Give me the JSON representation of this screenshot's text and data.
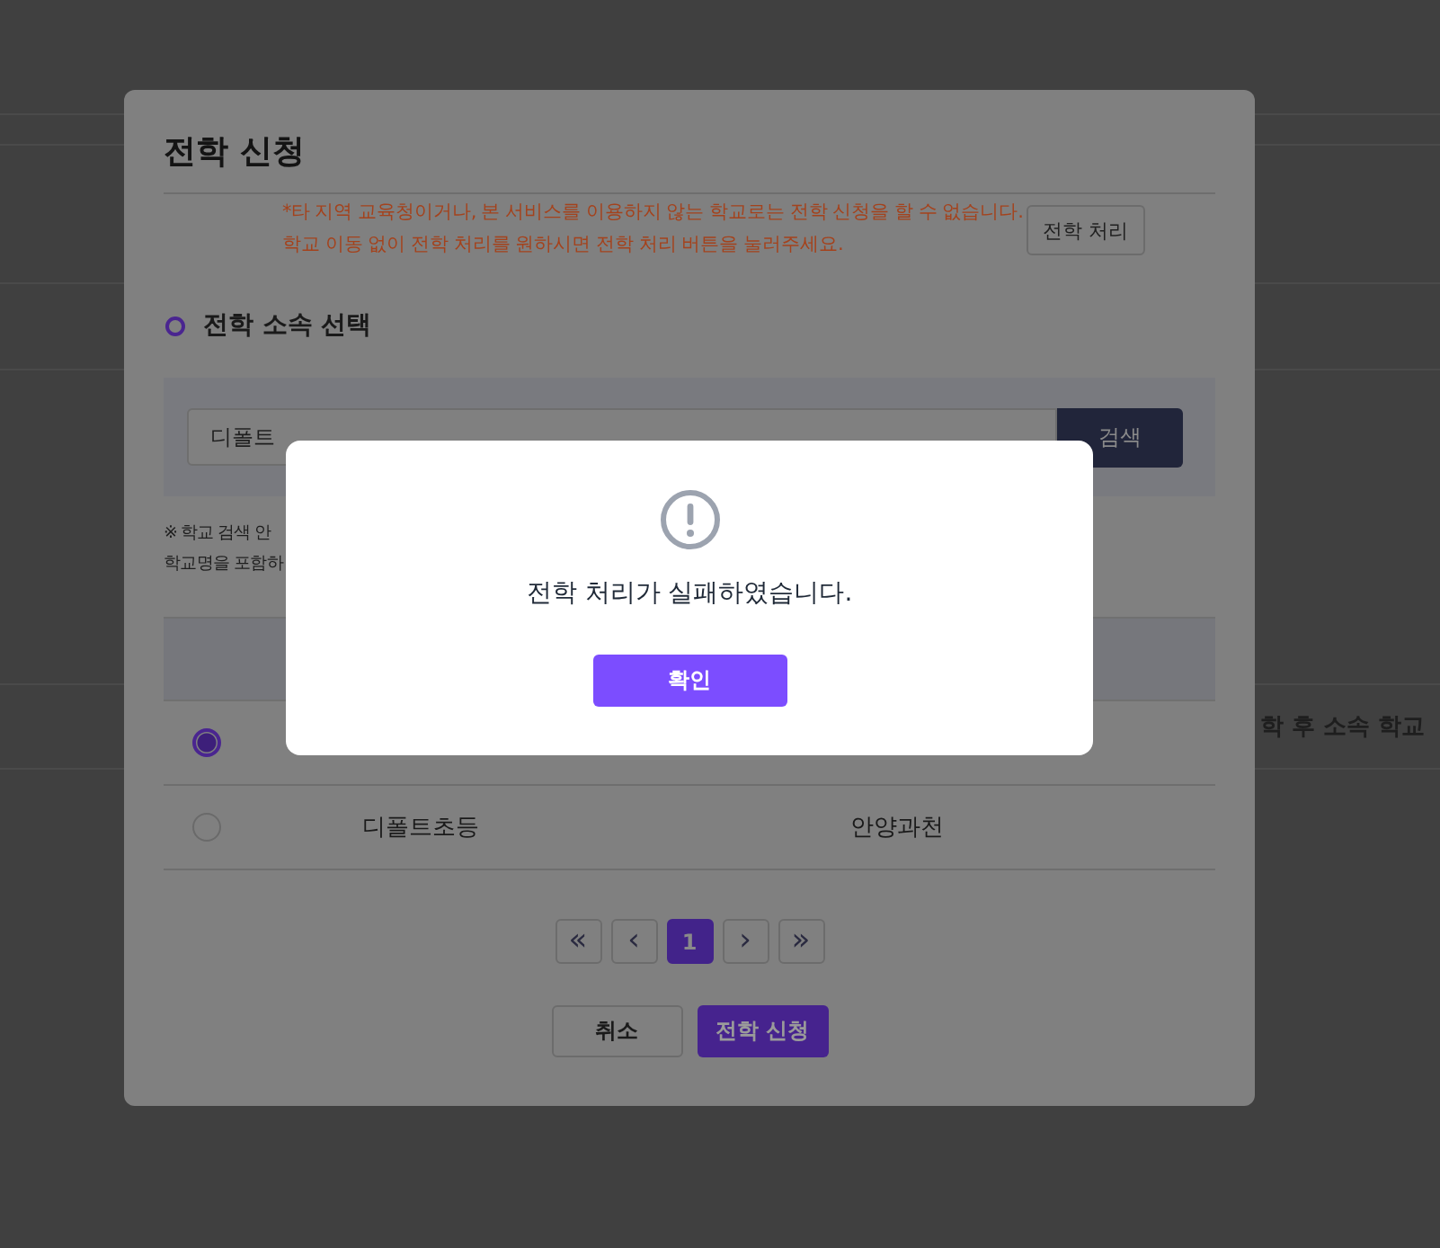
{
  "background": {
    "cut_header": "학 후 소속 학교"
  },
  "modal": {
    "title": "전학 신청",
    "notice": [
      "*타 지역 교육청이거나, 본 서비스를 이용하지 않는 학교로는 전학 신청을 할 수 없습니다.",
      "학교 이동 없이 전학 처리를 원하시면 전학 처리 버튼을 눌러주세요."
    ],
    "transfer_button": "전학 처리",
    "section_title": "전학 소속 선택",
    "search": {
      "value": "디폴트",
      "button": "검색"
    },
    "search_notes": [
      "※ 학교 검색 안",
      "학교명을 포함하"
    ],
    "rows": [
      {
        "selected": true
      },
      {
        "selected": false,
        "name": "디폴트초등",
        "region": "안양과천"
      }
    ],
    "pagination": {
      "first": "«",
      "prev": "‹",
      "pages": [
        {
          "label": "1",
          "selected": true
        }
      ],
      "next": "›",
      "last": "»"
    },
    "buttons": {
      "cancel": "취소",
      "submit": "전학 신청"
    }
  },
  "alert": {
    "message": "전학 처리가 실패하였습니다.",
    "button": "확인"
  }
}
